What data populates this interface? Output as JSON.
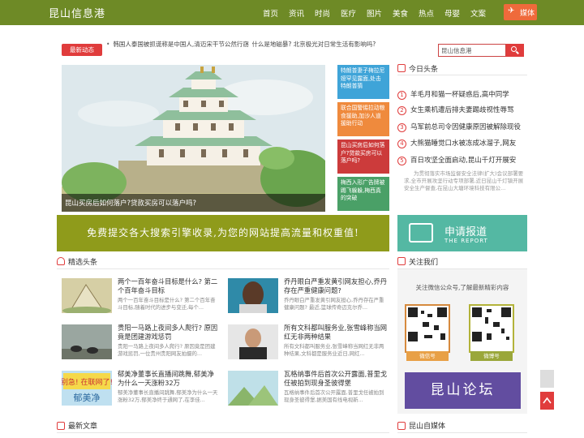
{
  "header": {
    "logo": "昆山信息港",
    "nav": [
      "首页",
      "资讯",
      "时尚",
      "医疗",
      "图片",
      "美食",
      "热点",
      "母婴",
      "文案"
    ],
    "media_button": "媒体"
  },
  "ticker": {
    "tag": "最新动态",
    "items": [
      "韩国人泰国被抓谎称是中国人,清迈宋干节公然行窃",
      "什么是地磁暴? 北京极光对日常生活有影响吗?"
    ]
  },
  "search": {
    "value": "昆山信息港"
  },
  "hero": {
    "caption": "昆山买房后如何落户?贷款买房可以落户吗?"
  },
  "side_tiles": [
    {
      "text": "特朗普妻子梅拉尼娅罕见露面,处击特朗普猜",
      "color": "#3fa4d8"
    },
    {
      "text": "联合国警惕拉动粮食援助,加沙人道援助行动",
      "color": "#ef8a3d"
    },
    {
      "text": "昆山买房后如何落户?贷款买房可以落户吗?",
      "color": "#cc3b3b"
    },
    {
      "text": "梅西入形广告牌被踢飞躲躲,梅西真的突破",
      "color": "#4aa067"
    }
  ],
  "ad_banner": "免费提交各大搜索引擎收录,为您的网站提高流量和权重值!",
  "today": {
    "title": "今日头条",
    "items": [
      "羊毛月和猫一杯疑惑后,高中同学",
      "女生乘机遭后排夫妻踢歧视性辱骂",
      "乌军前总司令因健康原因被解除现役",
      "大熊猫睡觉口水被冻成冰溜子,网友",
      "百日攻坚全面启动,昆山千灯开展安"
    ],
    "summary": "为贯彻落实市场监督安全法律(扩大)会议部署要求,全市开展攻坚行动专项部署,近日昆山千灯镇开展安全生产督查,在昆山大塘环境科技有限公..."
  },
  "report_banner": {
    "line1": "申请报道",
    "line2": "THE REPORT"
  },
  "picks": {
    "title": "精选头条",
    "items": [
      {
        "title": "两个一百年奋斗目标是什么? 第二个百年奋斗目标",
        "summary": "两个一百年奋斗目标是什么? 第二个百年奋斗目标,随着时代的进步与变迁,每个..."
      },
      {
        "title": "乔丹眼白严重发黄引网友担心,乔丹存在严重健康问题?",
        "summary": "乔丹眼白严重发黄引网友担心,乔丹存在严重健康问题? 最近,篮球传奇迈克尔乔..."
      },
      {
        "title": "贵阳一马路上夜间多人爬行? 原因竟是团建游戏惩罚",
        "summary": "贵阳一马路上夜间多人爬行? 原因竟是团建游戏惩罚,一位贵州贵阳网友拍摄的..."
      },
      {
        "title": "所有文科都叫服务业,张雪峰称当网红无非两种结果",
        "summary": "所有文科都叫服务业,张雪峰称当网红无非两种结果,文科都是服务业近日,网红..."
      },
      {
        "title": "郁美净董事长直播间跳舞,郁美净为什么一天涨粉32万",
        "summary": "郁美净董事长直播间跳舞,郁美净为什么一天涨粉32万,郁美净终于通网了,在李佳..."
      },
      {
        "title": "瓦格纳事件后首次公开露面,普里戈任被拍到现身圣彼得堡",
        "summary": "瓦格纳事件后首次公开露面,普里戈任被拍到现身圣彼得堡,据美国有线电视新..."
      }
    ]
  },
  "follow": {
    "title": "关注我们",
    "description": "关注微信公众号,了解最新精彩内容",
    "qr_labels": [
      "微信号",
      "微博号"
    ],
    "banner": "昆山论坛"
  },
  "latest": {
    "title": "最新文章"
  },
  "self_media": {
    "title": "昆山自媒体"
  },
  "colors": {
    "brand": "#6e8a26",
    "accent": "#e03c3c",
    "ad": "#8f9b1b",
    "report": "#54b8a3",
    "forum": "#624da0"
  }
}
